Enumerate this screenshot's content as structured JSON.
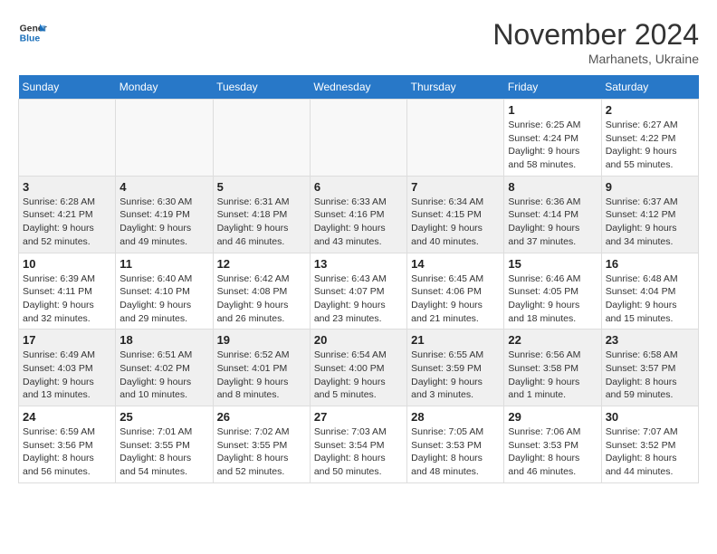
{
  "logo": {
    "text_general": "General",
    "text_blue": "Blue"
  },
  "header": {
    "month": "November 2024",
    "location": "Marhanets, Ukraine"
  },
  "days_of_week": [
    "Sunday",
    "Monday",
    "Tuesday",
    "Wednesday",
    "Thursday",
    "Friday",
    "Saturday"
  ],
  "weeks": [
    [
      {
        "day": "",
        "info": ""
      },
      {
        "day": "",
        "info": ""
      },
      {
        "day": "",
        "info": ""
      },
      {
        "day": "",
        "info": ""
      },
      {
        "day": "",
        "info": ""
      },
      {
        "day": "1",
        "info": "Sunrise: 6:25 AM\nSunset: 4:24 PM\nDaylight: 9 hours and 58 minutes."
      },
      {
        "day": "2",
        "info": "Sunrise: 6:27 AM\nSunset: 4:22 PM\nDaylight: 9 hours and 55 minutes."
      }
    ],
    [
      {
        "day": "3",
        "info": "Sunrise: 6:28 AM\nSunset: 4:21 PM\nDaylight: 9 hours and 52 minutes."
      },
      {
        "day": "4",
        "info": "Sunrise: 6:30 AM\nSunset: 4:19 PM\nDaylight: 9 hours and 49 minutes."
      },
      {
        "day": "5",
        "info": "Sunrise: 6:31 AM\nSunset: 4:18 PM\nDaylight: 9 hours and 46 minutes."
      },
      {
        "day": "6",
        "info": "Sunrise: 6:33 AM\nSunset: 4:16 PM\nDaylight: 9 hours and 43 minutes."
      },
      {
        "day": "7",
        "info": "Sunrise: 6:34 AM\nSunset: 4:15 PM\nDaylight: 9 hours and 40 minutes."
      },
      {
        "day": "8",
        "info": "Sunrise: 6:36 AM\nSunset: 4:14 PM\nDaylight: 9 hours and 37 minutes."
      },
      {
        "day": "9",
        "info": "Sunrise: 6:37 AM\nSunset: 4:12 PM\nDaylight: 9 hours and 34 minutes."
      }
    ],
    [
      {
        "day": "10",
        "info": "Sunrise: 6:39 AM\nSunset: 4:11 PM\nDaylight: 9 hours and 32 minutes."
      },
      {
        "day": "11",
        "info": "Sunrise: 6:40 AM\nSunset: 4:10 PM\nDaylight: 9 hours and 29 minutes."
      },
      {
        "day": "12",
        "info": "Sunrise: 6:42 AM\nSunset: 4:08 PM\nDaylight: 9 hours and 26 minutes."
      },
      {
        "day": "13",
        "info": "Sunrise: 6:43 AM\nSunset: 4:07 PM\nDaylight: 9 hours and 23 minutes."
      },
      {
        "day": "14",
        "info": "Sunrise: 6:45 AM\nSunset: 4:06 PM\nDaylight: 9 hours and 21 minutes."
      },
      {
        "day": "15",
        "info": "Sunrise: 6:46 AM\nSunset: 4:05 PM\nDaylight: 9 hours and 18 minutes."
      },
      {
        "day": "16",
        "info": "Sunrise: 6:48 AM\nSunset: 4:04 PM\nDaylight: 9 hours and 15 minutes."
      }
    ],
    [
      {
        "day": "17",
        "info": "Sunrise: 6:49 AM\nSunset: 4:03 PM\nDaylight: 9 hours and 13 minutes."
      },
      {
        "day": "18",
        "info": "Sunrise: 6:51 AM\nSunset: 4:02 PM\nDaylight: 9 hours and 10 minutes."
      },
      {
        "day": "19",
        "info": "Sunrise: 6:52 AM\nSunset: 4:01 PM\nDaylight: 9 hours and 8 minutes."
      },
      {
        "day": "20",
        "info": "Sunrise: 6:54 AM\nSunset: 4:00 PM\nDaylight: 9 hours and 5 minutes."
      },
      {
        "day": "21",
        "info": "Sunrise: 6:55 AM\nSunset: 3:59 PM\nDaylight: 9 hours and 3 minutes."
      },
      {
        "day": "22",
        "info": "Sunrise: 6:56 AM\nSunset: 3:58 PM\nDaylight: 9 hours and 1 minute."
      },
      {
        "day": "23",
        "info": "Sunrise: 6:58 AM\nSunset: 3:57 PM\nDaylight: 8 hours and 59 minutes."
      }
    ],
    [
      {
        "day": "24",
        "info": "Sunrise: 6:59 AM\nSunset: 3:56 PM\nDaylight: 8 hours and 56 minutes."
      },
      {
        "day": "25",
        "info": "Sunrise: 7:01 AM\nSunset: 3:55 PM\nDaylight: 8 hours and 54 minutes."
      },
      {
        "day": "26",
        "info": "Sunrise: 7:02 AM\nSunset: 3:55 PM\nDaylight: 8 hours and 52 minutes."
      },
      {
        "day": "27",
        "info": "Sunrise: 7:03 AM\nSunset: 3:54 PM\nDaylight: 8 hours and 50 minutes."
      },
      {
        "day": "28",
        "info": "Sunrise: 7:05 AM\nSunset: 3:53 PM\nDaylight: 8 hours and 48 minutes."
      },
      {
        "day": "29",
        "info": "Sunrise: 7:06 AM\nSunset: 3:53 PM\nDaylight: 8 hours and 46 minutes."
      },
      {
        "day": "30",
        "info": "Sunrise: 7:07 AM\nSunset: 3:52 PM\nDaylight: 8 hours and 44 minutes."
      }
    ]
  ]
}
